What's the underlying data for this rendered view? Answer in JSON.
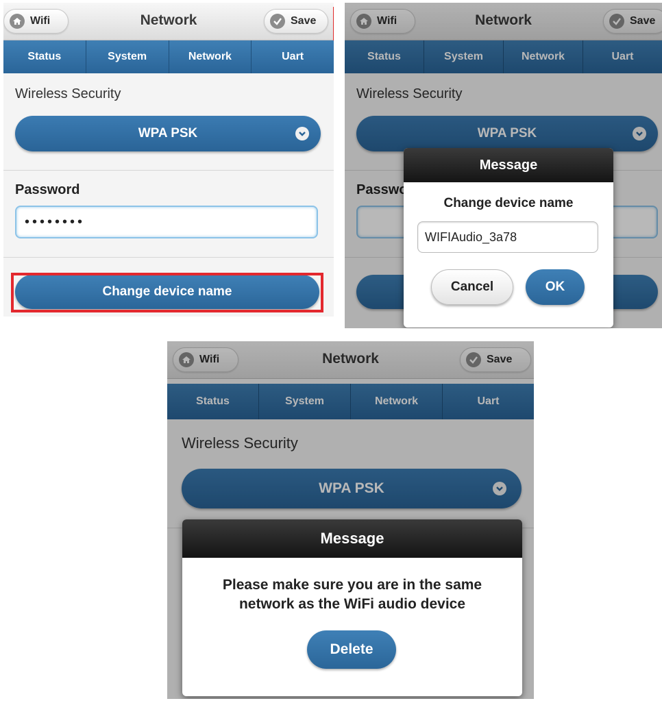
{
  "header": {
    "title": "Network",
    "back_label": "Wifi",
    "save_label": "Save"
  },
  "tabs": [
    "Status",
    "System",
    "Network",
    "Uart"
  ],
  "form": {
    "wireless_security_label": "Wireless Security",
    "wireless_security_value": "WPA PSK",
    "password_label": "Password",
    "password_value": "••••••••",
    "change_name_button": "Change device name"
  },
  "rename_dialog": {
    "title": "Message",
    "heading": "Change device name",
    "input_value": "WIFIAudio_3a78",
    "cancel_label": "Cancel",
    "ok_label": "OK"
  },
  "warning_dialog": {
    "title": "Message",
    "message_line1": "Please make sure you are in the same",
    "message_line2": "network as the WiFi audio device",
    "delete_label": "Delete"
  },
  "colors": {
    "accent_blue": "#2f6ea3",
    "highlight_red": "#e3282e",
    "dialog_header": "#1e1e1e"
  },
  "icons": {
    "back": "home-icon",
    "save": "check-circle-icon",
    "dropdown": "chevron-down-icon"
  }
}
